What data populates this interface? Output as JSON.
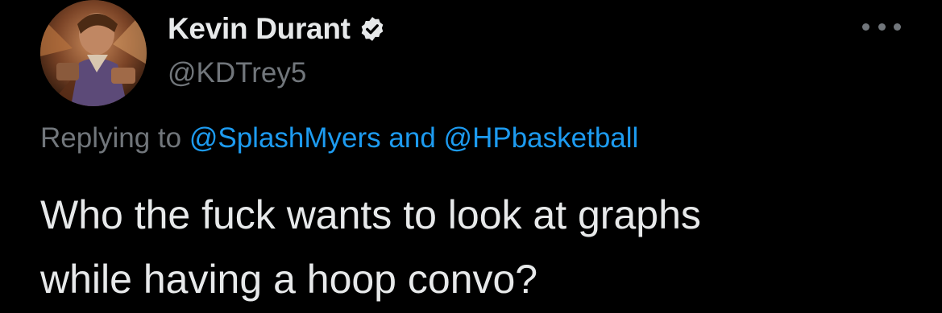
{
  "user": {
    "display_name": "Kevin Durant",
    "handle": "@KDTrey5",
    "verified": true
  },
  "reply": {
    "prefix": "Replying to",
    "mention_1": "@SplashMyers",
    "conjunction": "and",
    "mention_2": "@HPbasketball"
  },
  "tweet": {
    "line_1": "Who the fuck wants to look at graphs",
    "line_2": "while having a hoop convo?"
  },
  "icons": {
    "verified": "verified-badge-icon",
    "more": "more-options-icon"
  },
  "colors": {
    "background": "#000000",
    "primary_text": "#e7e9ea",
    "secondary_text": "#71767b",
    "link": "#1d9bf0"
  }
}
